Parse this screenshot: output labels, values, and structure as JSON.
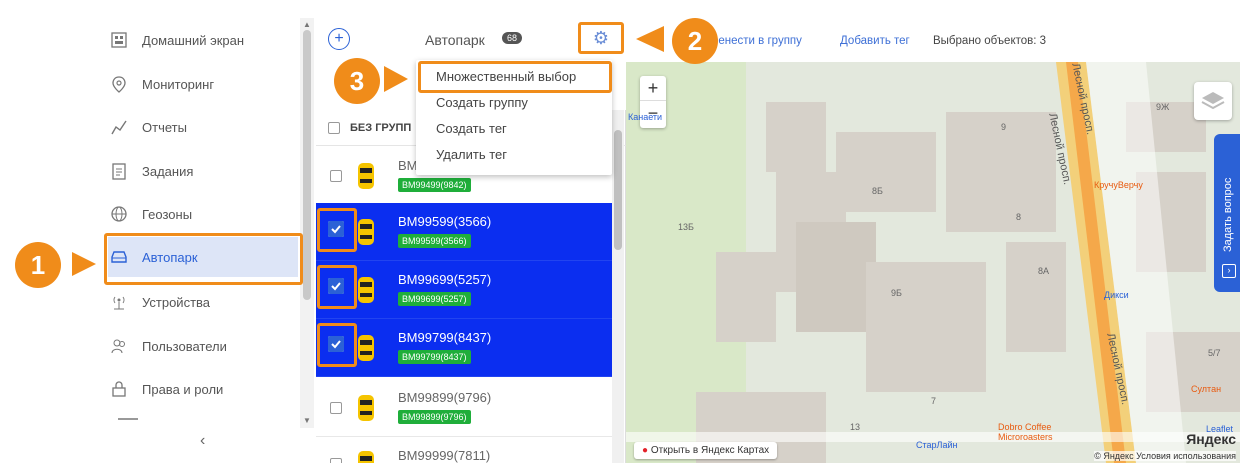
{
  "sidebar": {
    "items": [
      {
        "label": "Домашний экран",
        "icon": "home-icon"
      },
      {
        "label": "Мониторинг",
        "icon": "map-pin-icon"
      },
      {
        "label": "Отчеты",
        "icon": "chart-line-icon"
      },
      {
        "label": "Задания",
        "icon": "clipboard-icon"
      },
      {
        "label": "Геозоны",
        "icon": "globe-icon"
      },
      {
        "label": "Автопарк",
        "icon": "car-icon",
        "active": true
      },
      {
        "label": "Устройства",
        "icon": "antenna-icon"
      },
      {
        "label": "Пользователи",
        "icon": "users-icon"
      },
      {
        "label": "Права и роли",
        "icon": "lock-icon"
      }
    ],
    "collapse": "‹"
  },
  "toolbar": {
    "add": "+",
    "title": "Автопарк",
    "count": "68",
    "move_to_group": "ренести в группу",
    "add_tag": "Добавить тег",
    "selected": "Выбрано объектов: 3"
  },
  "menu": {
    "items": [
      "Множественный выбор",
      "Создать группу",
      "Создать тег",
      "Удалить тег"
    ]
  },
  "list": {
    "group_header": "БЕЗ ГРУПП",
    "vehicles": [
      {
        "name": "BM",
        "tag": "BM99499(9842)",
        "selected": false
      },
      {
        "name": "BM99599(3566)",
        "tag": "BM99599(3566)",
        "selected": true
      },
      {
        "name": "BM99699(5257)",
        "tag": "BM99699(5257)",
        "selected": true
      },
      {
        "name": "BM99799(8437)",
        "tag": "BM99799(8437)",
        "selected": true
      },
      {
        "name": "BM99899(9796)",
        "tag": "BM99899(9796)",
        "selected": false
      },
      {
        "name": "BM99999(7811)",
        "tag": "",
        "selected": false
      }
    ]
  },
  "map": {
    "street1": "Лесной просп.",
    "street2": "Лесной просп.",
    "street3": "Лесной просп.",
    "poi_kruchu": "КручуВерчу",
    "poi_dixy": "Дикси",
    "poi_sultan": "Султан",
    "poi_starline": "СтарЛайн",
    "poi_dobro": "Dobro Coffee Microroasters",
    "poi_kanaeti": "Канаети",
    "open_maps": "Открыть в Яндекс Картах",
    "logo": "Яндекс",
    "terms": "© Яндекс Условия использования",
    "leaflet": "Leaflet",
    "ask": "Задать вопрос",
    "numbers": [
      "9Ж",
      "9",
      "8Б",
      "8",
      "13Б",
      "8А",
      "9Б",
      "5/7",
      "7",
      "13"
    ]
  },
  "annotations": [
    "1",
    "2",
    "3"
  ],
  "colors": {
    "accent": "#2b61d6",
    "annotation": "#f08c1a",
    "selected_row": "#0b2ef0",
    "tag": "#1fae3a"
  }
}
